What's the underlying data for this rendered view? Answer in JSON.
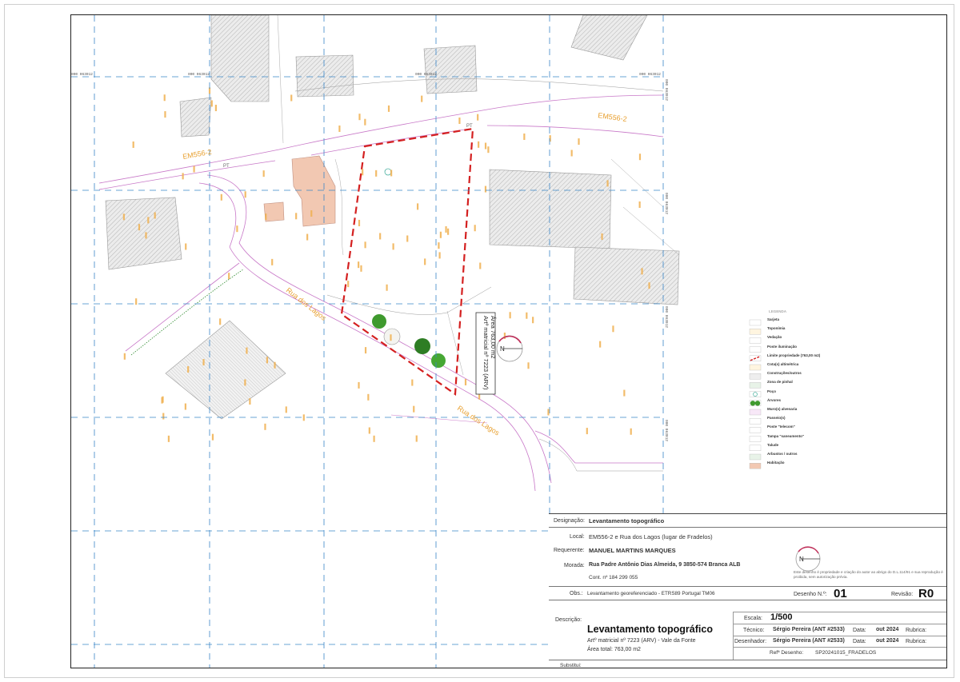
{
  "map": {
    "road_labels": [
      "EM556-2",
      "EM556-2",
      "Rua dos Lagos",
      "Rua dos Lagos"
    ],
    "parcel_label_line1": "Artº matricial nº 7223 (ARV)",
    "parcel_label_line2": "Área 763,00 m2",
    "north_letter": "N",
    "pt_label": "PT",
    "grid_top": [
      "000 063012",
      "000 063012",
      "000 063012",
      "000 063012"
    ],
    "grid_right": [
      "000 063012",
      "000 063012",
      "000 063012",
      "000 063012",
      "000 063012"
    ]
  },
  "legend": {
    "title": "LEGENDA",
    "items": [
      {
        "label": "Sarjeta",
        "icon": "gutter-icon"
      },
      {
        "label": "Toponímia",
        "icon": "toponym-icon"
      },
      {
        "label": "Vedação",
        "icon": "fence-icon"
      },
      {
        "label": "Poste iluminação",
        "icon": "lamp-post-icon"
      },
      {
        "label": "Limite propriedade (763,00 m2)",
        "icon": "property-limit-icon"
      },
      {
        "label": "Cota(s) altimétrica",
        "icon": "elevation-icon"
      },
      {
        "label": "Construções/outros",
        "icon": "construction-icon"
      },
      {
        "label": "Zona de pinhal",
        "icon": "pine-zone-icon"
      },
      {
        "label": "Poço",
        "icon": "well-icon"
      },
      {
        "label": "Árvores",
        "icon": "trees-icon"
      },
      {
        "label": "Muro(s) alvenaria",
        "icon": "masonry-wall-icon"
      },
      {
        "label": "Passeio(s)",
        "icon": "sidewalk-icon"
      },
      {
        "label": "Poste \"telecom\"",
        "icon": "telecom-post-icon"
      },
      {
        "label": "Tampa \"saneamento\"",
        "icon": "manhole-icon"
      },
      {
        "label": "Talude",
        "icon": "slope-icon"
      },
      {
        "label": "Arbustos / outros",
        "icon": "shrubs-icon"
      },
      {
        "label": "Habitação",
        "icon": "housing-icon"
      }
    ]
  },
  "title_block": {
    "designacao_label": "Designação:",
    "designacao_value": "Levantamento topográfico",
    "local_label": "Local:",
    "local_value": "EM556-2 e Rua dos Lagos (lugar de Fradelos)",
    "requerente_label": "Requerente:",
    "requerente_value": "MANUEL MARTINS MARQUES",
    "morada_label": "Morada:",
    "morada_value": "Rua Padre Antônio Dias Almeida, 9 3850-574 Branca ALB",
    "cont_value": "Cont. nº 184 299 055",
    "copyright_note_1": "Este desenho é propriedade e criação do autor ao abrigo do D.L.114/91 e sua reprodução é",
    "copyright_note_2": "proibida, sem autorização prévia.",
    "obs_label": "Obs.:",
    "obs_value": "Levantamento georeferenciado - ETRS89 Portugal TM06",
    "desenho_label": "Desenho N.º:",
    "desenho_value": "01",
    "revisao_label": "Revisão:",
    "revisao_value": "R0",
    "descricao_label": "Descrição:",
    "descricao_title": "Levantamento topográfico",
    "descricao_line1": "Artº matricial nº 7223 (ARV) - Vale da Fonte",
    "descricao_line2": "Área total: 763,00 m2",
    "escala_label": "Escala:",
    "escala_value": "1/500",
    "tecnico_label": "Técnico:",
    "tecnico_value": "Sérgio Pereira (ANT #2533)",
    "desenhador_label": "Desenhador:",
    "desenhador_value": "Sérgio Pereira (ANT #2533)",
    "data_label": "Data:",
    "data_value_1": "out 2024",
    "data_value_2": "out 2024",
    "rubrica_label": "Rubrica:",
    "ref_label": "Refª Desenho:",
    "ref_value": "SP20241015_FRADELOS",
    "substitui_label": "Substitui:",
    "north_letter": "N"
  },
  "colors": {
    "grid": "#3a86c8",
    "road_label": "#e8a030",
    "property_limit": "#d42020",
    "house_fill": "#f2c8b2",
    "wall": "#c878c8",
    "vegetation": "#2d8a2d"
  }
}
